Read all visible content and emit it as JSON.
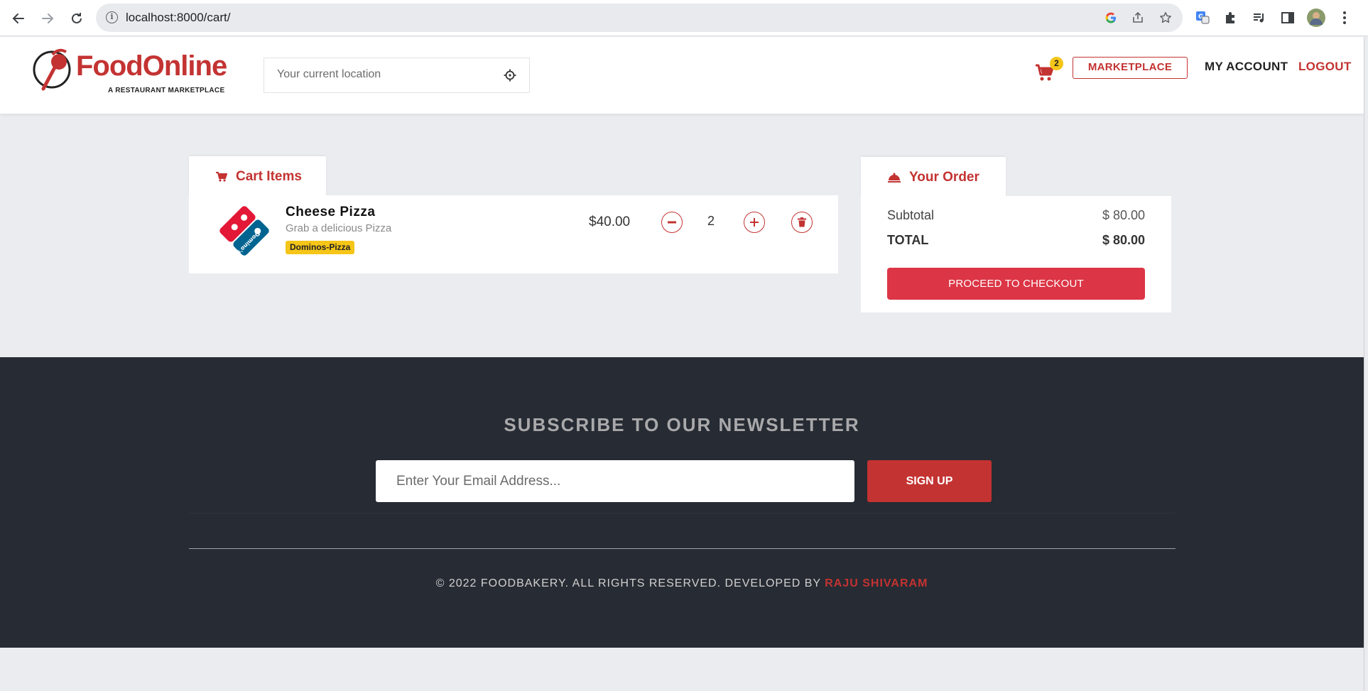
{
  "browser": {
    "url_host": "localhost",
    "url_rest": ":8000/cart/"
  },
  "header": {
    "logo_text": "FoodOnline",
    "logo_tagline": "A RESTAURANT MARKETPLACE",
    "location_placeholder": "Your current location",
    "cart_count": "2",
    "marketplace_label": "MARKETPLACE",
    "my_account_label": "MY ACCOUNT",
    "logout_label": "LOGOUT"
  },
  "cart": {
    "tab_label": "Cart Items",
    "items": [
      {
        "name": "Cheese Pizza",
        "description": "Grab a delicious Pizza",
        "vendor": "Dominos-Pizza",
        "price": "$40.00",
        "quantity": "2"
      }
    ]
  },
  "order": {
    "tab_label": "Your Order",
    "subtotal_label": "Subtotal",
    "subtotal_value": "$ 80.00",
    "total_label": "TOTAL",
    "total_value": "$ 80.00",
    "checkout_label": "PROCEED TO CHECKOUT"
  },
  "footer": {
    "newsletter_title": "SUBSCRIBE TO OUR NEWSLETTER",
    "email_placeholder": "Enter Your Email Address...",
    "signup_label": "SIGN UP",
    "copyright_text": "© 2022 FOODBAKERY. ALL RIGHTS RESERVED. DEVELOPED BY ",
    "developer_name": "RAJU SHIVARAM"
  },
  "colors": {
    "brand_red": "#c33332",
    "checkout_red": "#dc3545",
    "badge_yellow": "#f5c518",
    "footer_bg": "#272b33",
    "page_bg": "#ebecf0"
  },
  "icons": [
    "back-arrow-icon",
    "forward-arrow-icon",
    "reload-icon",
    "info-icon",
    "google-icon",
    "share-icon",
    "star-icon",
    "translate-icon",
    "puzzle-icon",
    "media-icon",
    "sidepanel-icon",
    "profile-avatar",
    "menu-dots-icon",
    "crosshair-icon",
    "cart-icon",
    "minus-circle-icon",
    "plus-circle-icon",
    "trash-icon",
    "food-bell-icon"
  ]
}
